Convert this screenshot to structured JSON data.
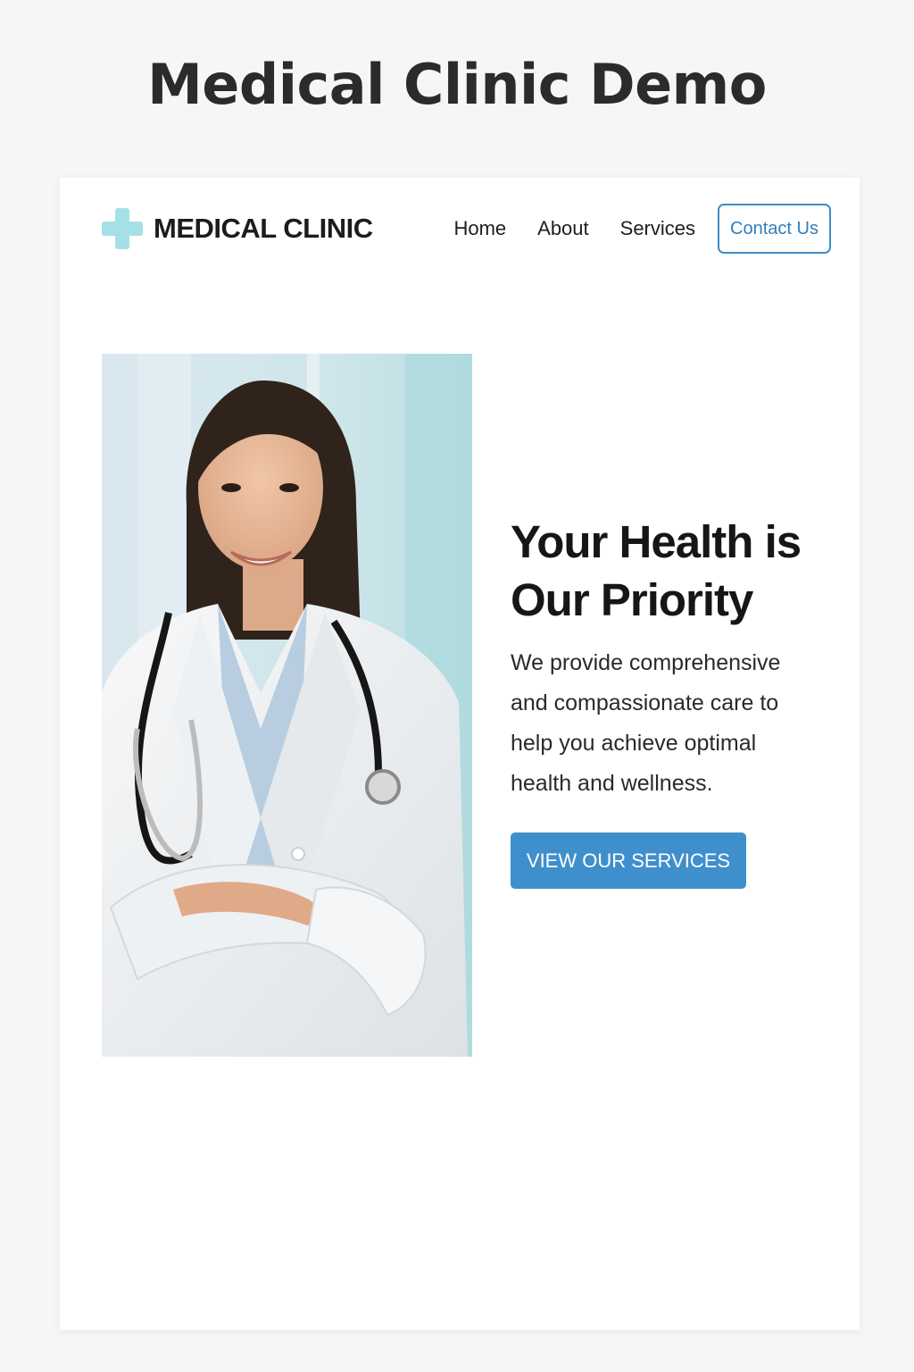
{
  "page": {
    "heading": "Medical Clinic Demo"
  },
  "header": {
    "logo_text": "MEDICAL CLINIC",
    "nav": {
      "home": "Home",
      "about": "About",
      "services": "Services",
      "contact": "Contact Us"
    }
  },
  "hero": {
    "title": "Your Health is Our Priority",
    "body": "We provide comprehensive and compassionate care to help you achieve optimal health and wellness.",
    "cta_label": "VIEW OUR SERVICES",
    "image_alt": "Smiling female doctor in white coat with stethoscope, arms crossed"
  },
  "colors": {
    "accent": "#3f8fcc",
    "logo_cross": "#a4e0e6",
    "page_background": "#f6f6f6"
  },
  "icons": {
    "logo": "medical-cross-icon"
  }
}
